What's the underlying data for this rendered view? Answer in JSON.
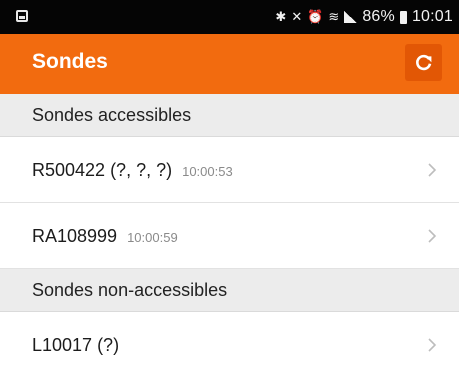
{
  "status_bar": {
    "battery": "86%",
    "time": "10:01"
  },
  "app_bar": {
    "title": "Sondes",
    "refresh_icon": "refresh-icon"
  },
  "sections": [
    {
      "header": "Sondes accessibles",
      "items": [
        {
          "name": "R500422 (?, ?, ?)",
          "time": "10:00:53"
        },
        {
          "name": "RA108999",
          "time": "10:00:59"
        }
      ]
    },
    {
      "header": "Sondes non-accessibles",
      "items": [
        {
          "name": "L10017 (?)",
          "time": ""
        }
      ]
    }
  ],
  "colors": {
    "app_bar": "#f26b0f",
    "refresh_button": "#e25705",
    "status_bar": "#050505",
    "section_header_bg": "#ececec"
  }
}
